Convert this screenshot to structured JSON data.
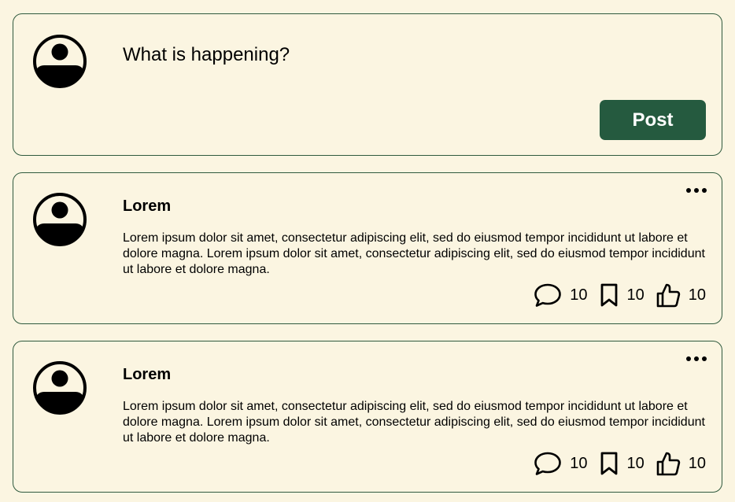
{
  "composer": {
    "placeholder": "What is happening?",
    "post_label": "Post",
    "avatar_icon": "user-avatar-icon"
  },
  "posts": [
    {
      "author": "Lorem",
      "body": "Lorem ipsum dolor sit amet, consectetur adipiscing elit, sed do eiusmod tempor incididunt ut labore et dolore magna. Lorem ipsum dolor sit amet, consectetur adipiscing elit, sed do eiusmod tempor incididunt ut labore et dolore magna.",
      "comments": "10",
      "bookmarks": "10",
      "likes": "10"
    },
    {
      "author": "Lorem",
      "body": "Lorem ipsum dolor sit amet, consectetur adipiscing elit, sed do eiusmod tempor incididunt ut labore et dolore magna. Lorem ipsum dolor sit amet, consectetur adipiscing elit, sed do eiusmod tempor incididunt ut labore et dolore magna.",
      "comments": "10",
      "bookmarks": "10",
      "likes": "10"
    }
  ],
  "icons": {
    "menu": "more-horizontal-icon",
    "comment": "comment-icon",
    "bookmark": "bookmark-icon",
    "like": "thumbs-up-icon"
  },
  "colors": {
    "background": "#fbf5e1",
    "border": "#2f5a3e",
    "post_button": "#255a3f"
  }
}
